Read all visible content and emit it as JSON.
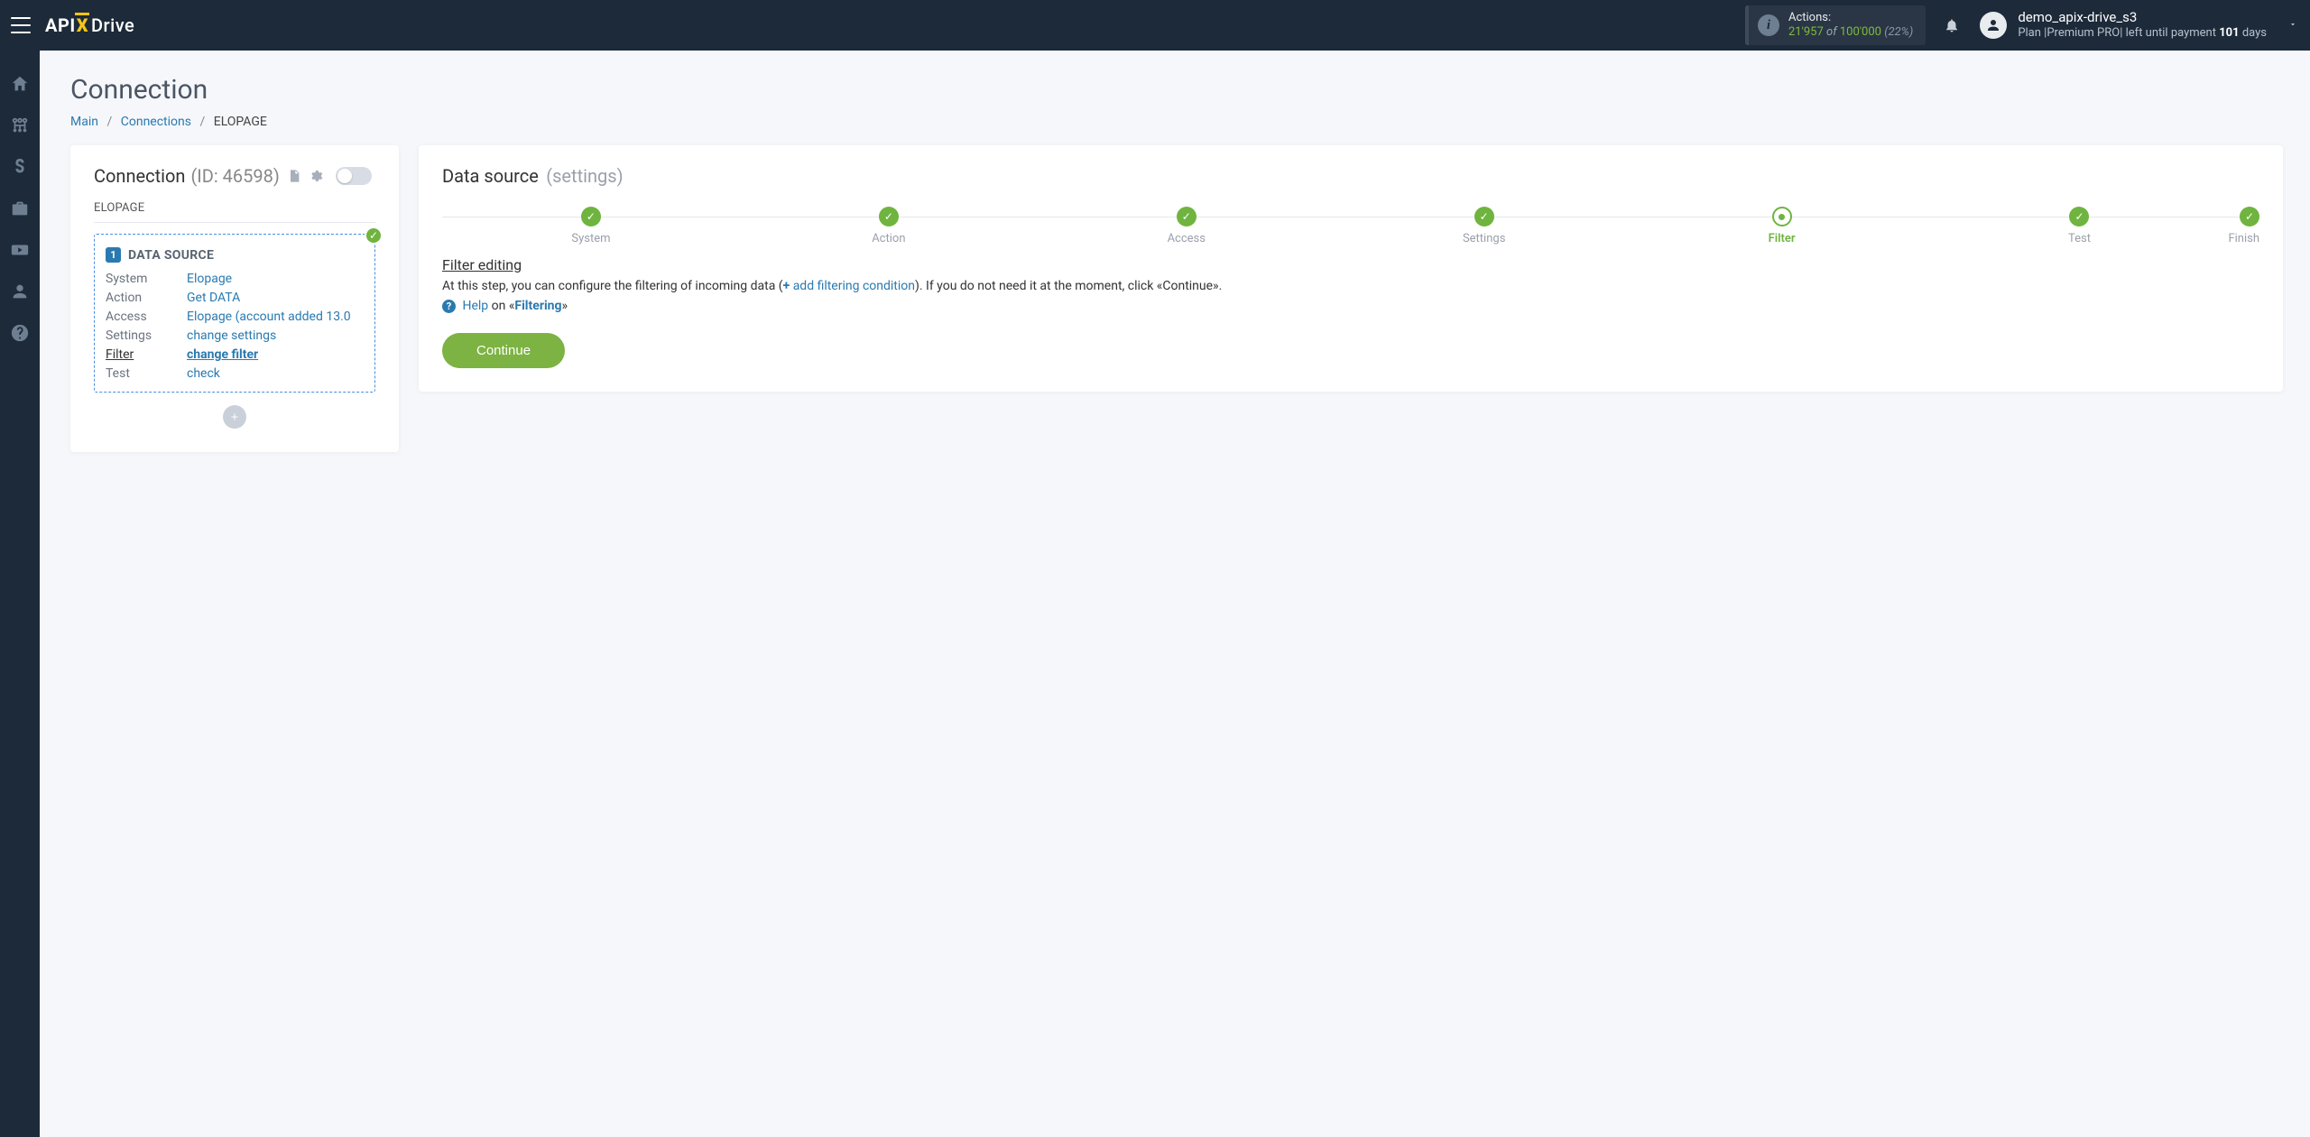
{
  "header": {
    "logo": {
      "api": "API",
      "x": "X",
      "drive": "Drive"
    },
    "actions": {
      "label": "Actions:",
      "count": "21'957",
      "of": "of",
      "total": "100'000",
      "pct": "(22%)"
    },
    "user": {
      "name": "demo_apix-drive_s3",
      "plan_prefix": "Plan |",
      "plan_name": "Premium PRO",
      "plan_mid": "| left until payment ",
      "plan_days": "101",
      "plan_suffix": " days"
    }
  },
  "sidebar": {
    "items": [
      {
        "name": "home"
      },
      {
        "name": "connections"
      },
      {
        "name": "billing"
      },
      {
        "name": "briefcase"
      },
      {
        "name": "video"
      },
      {
        "name": "account"
      },
      {
        "name": "help"
      }
    ]
  },
  "page": {
    "title": "Connection",
    "breadcrumb": {
      "main": "Main",
      "connections": "Connections",
      "current": "ELOPAGE"
    }
  },
  "left": {
    "title": "Connection",
    "id_label": "(ID: 46598)",
    "sub": "ELOPAGE",
    "ds": {
      "num": "1",
      "title": "DATA SOURCE",
      "rows": {
        "system_k": "System",
        "system_v": "Elopage",
        "action_k": "Action",
        "action_v": "Get DATA",
        "access_k": "Access",
        "access_v": "Elopage (account added 13.0",
        "settings_k": "Settings",
        "settings_v": "change settings",
        "filter_k": "Filter",
        "filter_v": "change filter",
        "test_k": "Test",
        "test_v": "check"
      }
    }
  },
  "right": {
    "title": "Data source",
    "title_sub": "(settings)",
    "steps": {
      "system": "System",
      "action": "Action",
      "access": "Access",
      "settings": "Settings",
      "filter": "Filter",
      "test": "Test",
      "finish": "Finish"
    },
    "filter_editing": "Filter editing",
    "desc_1": "At this step, you can configure the filtering of incoming data (",
    "add_cond": "add filtering condition",
    "desc_2": "). If you do not need it at the moment, click «Continue».",
    "help_word": "Help",
    "help_mid": " on «",
    "help_topic": "Filtering",
    "help_end": "»",
    "continue": "Continue"
  }
}
